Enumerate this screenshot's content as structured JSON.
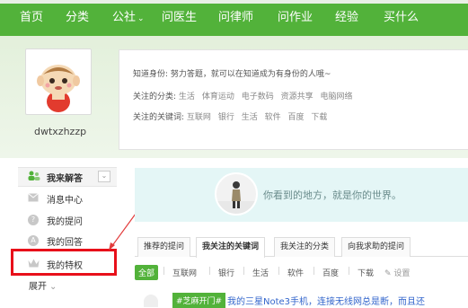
{
  "nav": {
    "items": [
      {
        "label": "首页"
      },
      {
        "label": "分类"
      },
      {
        "label": "公社"
      },
      {
        "label": "问医生"
      },
      {
        "label": "问律师"
      },
      {
        "label": "问作业"
      },
      {
        "label": "经验"
      },
      {
        "label": "买什么"
      }
    ],
    "caret": "⌄"
  },
  "profile": {
    "username": "dwtxzhzzp",
    "identity_label": "知道身份:",
    "identity_value": "努力答题，就可以在知道成为有身份的人哦~",
    "categories_label": "关注的分类:",
    "categories": [
      "生活",
      "体育运动",
      "电子数码",
      "资源共享",
      "电脑网络"
    ],
    "keywords_label": "关注的关键词:",
    "keywords": [
      "互联网",
      "银行",
      "生活",
      "软件",
      "百度",
      "下载"
    ]
  },
  "sidebar": {
    "header": "我来解答",
    "items": [
      {
        "label": "消息中心"
      },
      {
        "label": "我的提问"
      },
      {
        "label": "我的回答"
      },
      {
        "label": "我的特权"
      },
      {
        "label": "展开"
      }
    ],
    "expand_caret": "⌄"
  },
  "banner": {
    "text": "你看到的地方，就是你的世界。"
  },
  "tabs": [
    {
      "label": "推荐的提问"
    },
    {
      "label": "我关注的关键词"
    },
    {
      "label": "我关注的分类"
    },
    {
      "label": "向我求助的提问"
    }
  ],
  "filters": {
    "items": [
      "全部",
      "互联网",
      "银行",
      "生活",
      "软件",
      "百度",
      "下载"
    ],
    "settings": "设置"
  },
  "question": {
    "tag": "#芝麻开门#",
    "title": "我的三星Note3手机，连接无线网总是断，而且还"
  },
  "colors": {
    "brand_green": "#52b23a",
    "highlight_red": "#e8101a",
    "link_blue": "#3366cc"
  }
}
